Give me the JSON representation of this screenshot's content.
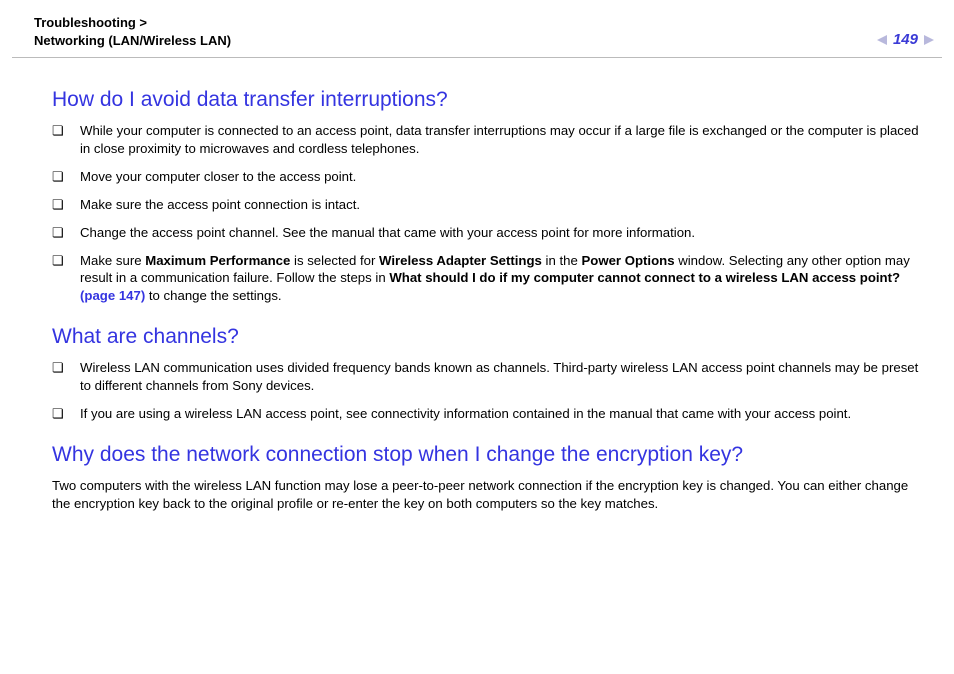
{
  "breadcrumb": {
    "line1": "Troubleshooting >",
    "line2": "Networking (LAN/Wireless LAN)"
  },
  "page_number": "149",
  "sections": [
    {
      "heading": "How do I avoid data transfer interruptions?",
      "bullets": [
        {
          "text": "While your computer is connected to an access point, data transfer interruptions may occur if a large file is exchanged or the computer is placed in close proximity to microwaves and cordless telephones."
        },
        {
          "text": "Move your computer closer to the access point."
        },
        {
          "text": "Make sure the access point connection is intact."
        },
        {
          "text": "Change the access point channel. See the manual that came with your access point for more information."
        },
        {
          "parts": [
            {
              "t": "Make sure "
            },
            {
              "t": "Maximum Performance",
              "b": true
            },
            {
              "t": " is selected for "
            },
            {
              "t": "Wireless Adapter Settings",
              "b": true
            },
            {
              "t": " in the "
            },
            {
              "t": "Power Options",
              "b": true
            },
            {
              "t": " window. Selecting any other option may result in a communication failure. Follow the steps in "
            },
            {
              "t": "What should I do if my computer cannot connect to a wireless LAN access point?",
              "b": true
            },
            {
              "t": " "
            },
            {
              "t": "(page 147)",
              "link": true
            },
            {
              "t": " to change the settings."
            }
          ]
        }
      ]
    },
    {
      "heading": "What are channels?",
      "bullets": [
        {
          "text": "Wireless LAN communication uses divided frequency bands known as channels. Third-party wireless LAN access point channels may be preset to different channels from Sony devices."
        },
        {
          "text": "If you are using a wireless LAN access point, see connectivity information contained in the manual that came with your access point."
        }
      ]
    },
    {
      "heading": "Why does the network connection stop when I change the encryption key?",
      "paragraph": "Two computers with the wireless LAN function may lose a peer-to-peer network connection if the encryption key is changed. You can either change the encryption key back to the original profile or re-enter the key on both computers so the key matches."
    }
  ]
}
